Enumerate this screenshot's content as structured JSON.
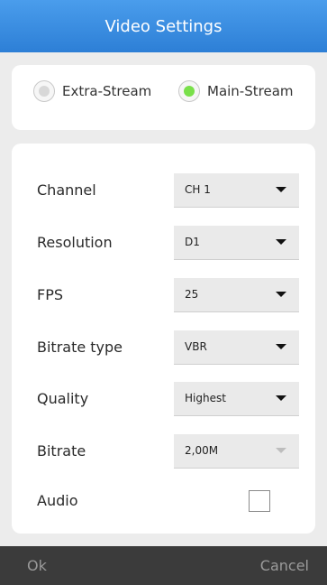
{
  "title": "Video Settings",
  "stream": {
    "options": [
      {
        "label": "Extra-Stream",
        "checked": false
      },
      {
        "label": "Main-Stream",
        "checked": true
      }
    ]
  },
  "settings": [
    {
      "label": "Channel",
      "value": "CH 1",
      "enabled": true
    },
    {
      "label": "Resolution",
      "value": "D1",
      "enabled": true
    },
    {
      "label": "FPS",
      "value": "25",
      "enabled": true
    },
    {
      "label": "Bitrate type",
      "value": "VBR",
      "enabled": true
    },
    {
      "label": "Quality",
      "value": "Highest",
      "enabled": true
    },
    {
      "label": "Bitrate",
      "value": "2,00M",
      "enabled": false
    }
  ],
  "audio": {
    "label": "Audio",
    "checked": false
  },
  "buttons": {
    "ok": "Ok",
    "cancel": "Cancel"
  },
  "colors": {
    "accent": "#2d7fd6",
    "radio_selected": "#79e04a",
    "bottom_bar": "#3b3b3b"
  }
}
